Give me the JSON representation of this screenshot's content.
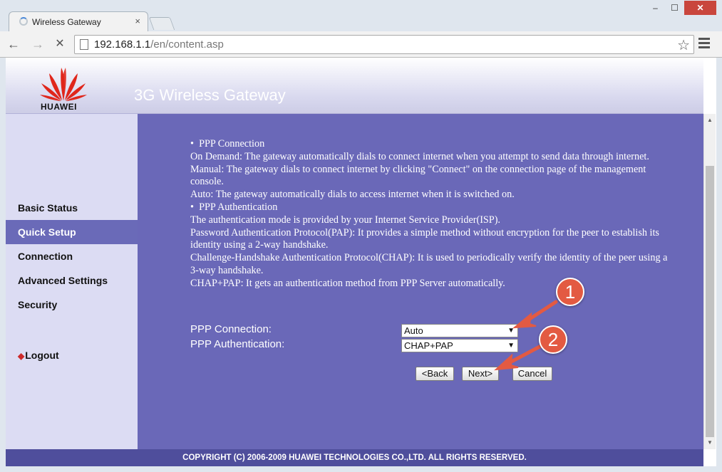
{
  "browser": {
    "tab_title": "Wireless Gateway",
    "tab_close": "×",
    "url_host": "192.168.1.1",
    "url_path": "/en/content.asp",
    "back": "←",
    "forward": "→",
    "stop": "✕",
    "star": "☆",
    "minimize": "–",
    "maximize": "☐",
    "close": "✕"
  },
  "header": {
    "brand": "HUAWEI",
    "title": "3G Wireless Gateway",
    "brand_color": "#e0261b"
  },
  "sidebar": {
    "items": [
      {
        "label": "Basic Status"
      },
      {
        "label": "Quick Setup",
        "active": true
      },
      {
        "label": "Connection"
      },
      {
        "label": "Advanced Settings"
      },
      {
        "label": "Security"
      }
    ],
    "logout": "Logout"
  },
  "help": {
    "ppp_connection_title": "PPP Connection",
    "on_demand": "On Demand: The gateway automatically dials to connect internet when you attempt to send data through internet.",
    "manual": "Manual: The gateway dials to connect internet by clicking \"Connect\" on the connection page of the management console.",
    "auto": "Auto: The gateway automatically dials to access internet when it is switched on.",
    "ppp_auth_title": "PPP Authentication",
    "auth_intro": "The authentication mode is provided by your Internet Service Provider(ISP).",
    "pap": "Password Authentication Protocol(PAP): It provides a simple method without encryption for the peer to establish its identity using a 2-way handshake.",
    "chap": "Challenge-Handshake Authentication Protocol(CHAP): It is used to periodically verify the identity of the peer using a 3-way handshake.",
    "chap_pap": "CHAP+PAP: It gets an authentication method from PPP Server automatically."
  },
  "form": {
    "ppp_connection_label": "PPP Connection:",
    "ppp_connection_value": "Auto",
    "ppp_auth_label": "PPP Authentication:",
    "ppp_auth_value": "CHAP+PAP"
  },
  "buttons": {
    "back": "<Back",
    "next": "Next>",
    "cancel": "Cancel"
  },
  "footer": {
    "copyright": "COPYRIGHT (C) 2006-2009 HUAWEI TECHNOLOGIES CO.,LTD. ALL RIGHTS RESERVED."
  },
  "annotations": {
    "marker_1": "1",
    "marker_2": "2",
    "marker_color": "#e35a42"
  },
  "colors": {
    "content_bg": "#6a68b8",
    "sidebar_bg": "#dcdcf3",
    "active_item_bg": "#6a6ab8",
    "footer_bg": "#4f4e9c"
  }
}
